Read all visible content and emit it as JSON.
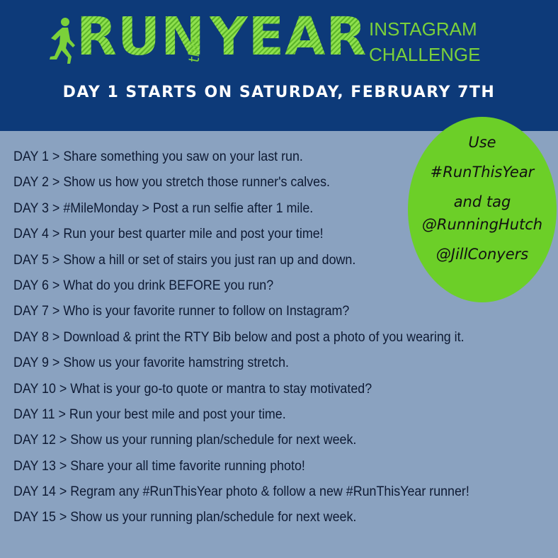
{
  "header": {
    "logo": {
      "run": "RUN",
      "this": "this",
      "year": "YEAR"
    },
    "challenge_line1": "INSTAGRAM",
    "challenge_line2": "CHALLENGE",
    "start_line": "DAY 1 STARTS ON SATURDAY, FEBRUARY 7TH"
  },
  "bubble": {
    "line1": "Use",
    "line2": "#RunThisYear",
    "line3": "and tag",
    "line4": "@RunningHutch",
    "line5": "@JillConyers"
  },
  "days": [
    "DAY 1 > Share something you saw on your last run.",
    "DAY 2 > Show us how you stretch those runner's calves.",
    "DAY 3 > #MileMonday > Post a run selfie after 1 mile.",
    "DAY 4 > Run your best quarter mile and post your time!",
    "DAY 5 > Show a hill or set of stairs you just ran up and down.",
    "DAY 6 > What do you drink BEFORE you run?",
    "DAY 7 > Who is your favorite runner to follow on Instagram?",
    "DAY 8 > Download & print the RTY Bib below and post a photo of you wearing it.",
    "DAY 9 > Show us your favorite hamstring stretch.",
    "DAY 10 > What is your go-to quote or mantra to stay motivated?",
    "DAY 11 > Run your best mile and post your time.",
    "DAY 12 > Show us your running plan/schedule for next week.",
    "DAY 13 > Share your all time favorite running photo!",
    "DAY 14 > Regram any #RunThisYear photo & follow a new #RunThisYear runner!",
    "DAY 15 > Show us your running plan/schedule for next week."
  ],
  "colors": {
    "header_bg": "#0d3a79",
    "body_bg": "#8aa2c0",
    "accent_green": "#7bd13a",
    "bubble_green": "#6ccf28"
  }
}
